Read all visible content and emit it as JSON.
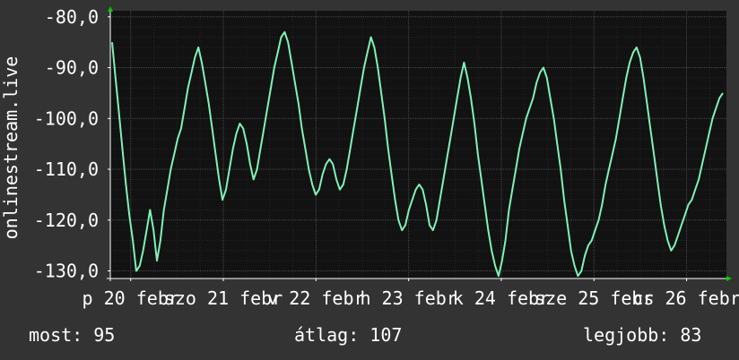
{
  "chart_data": {
    "type": "line",
    "ylabel": "onlinestream.live",
    "ylim": [
      -131.5,
      -78.8
    ],
    "yticks": [
      -80,
      -90,
      -100,
      -110,
      -120,
      -130
    ],
    "ytick_labels": [
      "-80,0",
      "-90,0",
      "-100,0",
      "-110,0",
      "-120,0",
      "-130,0"
    ],
    "xtick_labels": [
      "p 20 febr",
      "szo 21 febr",
      "v 22 febr",
      "h 23 febr",
      "k 24 febr",
      "sze 25 febr",
      "cs 26 febr"
    ],
    "grid": true,
    "colors": {
      "background": "#333333",
      "plot": "#121212",
      "line": "#7ff2b6",
      "grid_major": "#4a4a4a",
      "grid_minor": "#262626",
      "arrow": "#00cc00"
    },
    "series": [
      {
        "values": [
          -85,
          -92,
          -99,
          -106,
          -113,
          -119,
          -124,
          -130,
          -129,
          -126,
          -122,
          -118,
          -122,
          -128,
          -124,
          -118,
          -114,
          -110,
          -107,
          -104,
          -102,
          -98,
          -94,
          -91,
          -88,
          -86,
          -89,
          -93,
          -97,
          -102,
          -107,
          -112,
          -116,
          -114,
          -110,
          -106,
          -103,
          -101,
          -102,
          -105,
          -109,
          -112,
          -110,
          -106,
          -102,
          -98,
          -94,
          -90,
          -87,
          -84,
          -83,
          -85,
          -89,
          -93,
          -97,
          -102,
          -106,
          -110,
          -113,
          -115,
          -114,
          -111,
          -109,
          -108,
          -109,
          -112,
          -114,
          -113,
          -110,
          -106,
          -102,
          -98,
          -94,
          -90,
          -87,
          -84,
          -86,
          -90,
          -95,
          -100,
          -106,
          -111,
          -116,
          -120,
          -122,
          -121,
          -118,
          -116,
          -114,
          -113,
          -114,
          -117,
          -121,
          -122,
          -120,
          -116,
          -112,
          -108,
          -104,
          -100,
          -96,
          -92,
          -89,
          -92,
          -96,
          -101,
          -107,
          -112,
          -117,
          -122,
          -126,
          -129,
          -131,
          -128,
          -124,
          -118,
          -114,
          -110,
          -106,
          -103,
          -100,
          -98,
          -96,
          -93,
          -91,
          -90,
          -92,
          -96,
          -100,
          -105,
          -110,
          -116,
          -121,
          -126,
          -129,
          -131,
          -130,
          -127,
          -125,
          -124,
          -122,
          -120,
          -117,
          -113,
          -110,
          -107,
          -104,
          -100,
          -96,
          -92,
          -89,
          -87,
          -86,
          -88,
          -92,
          -97,
          -102,
          -107,
          -112,
          -117,
          -121,
          -124,
          -126,
          -125,
          -123,
          -121,
          -119,
          -117,
          -116,
          -114,
          -112,
          -109,
          -106,
          -103,
          -100,
          -98,
          -96,
          -95
        ]
      }
    ]
  },
  "stats": {
    "now": "most: 95",
    "avg": "átlag: 107",
    "best": "legjobb: 83"
  }
}
